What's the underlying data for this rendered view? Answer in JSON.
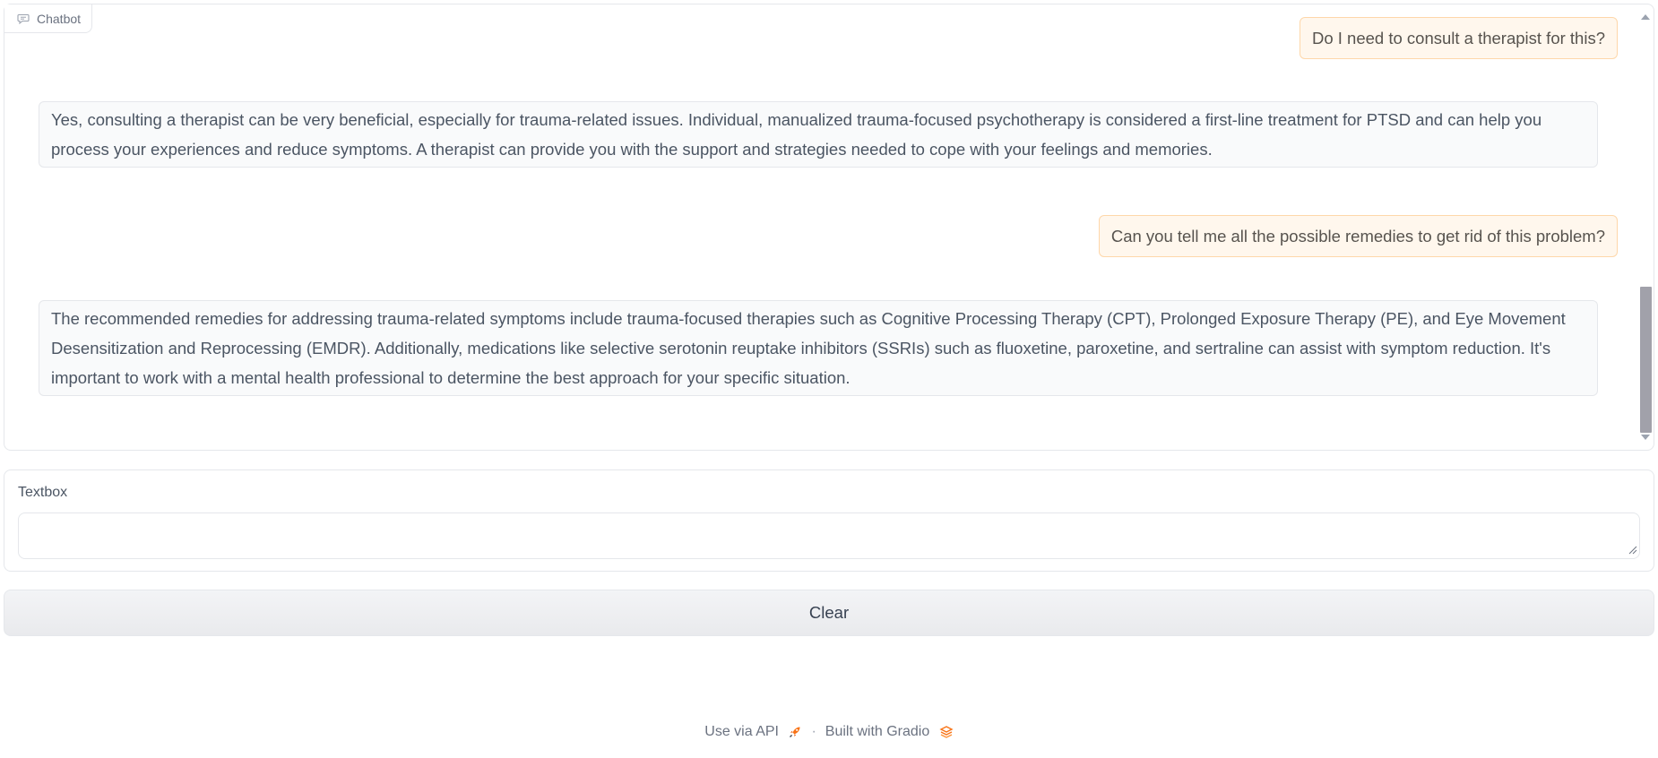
{
  "chatbot": {
    "label": "Chatbot",
    "messages": [
      {
        "role": "user",
        "text": "Do I need to consult a therapist for this?"
      },
      {
        "role": "bot",
        "text": "Yes, consulting a therapist can be very beneficial, especially for trauma-related issues. Individual, manualized trauma-focused psychotherapy is considered a first-line treatment for PTSD and can help you process your experiences and reduce symptoms. A therapist can provide you with the support and strategies needed to cope with your feelings and memories."
      },
      {
        "role": "user",
        "text": "Can you tell me all the possible remedies to get rid of this problem?"
      },
      {
        "role": "bot",
        "text": "The recommended remedies for addressing trauma-related symptoms include trauma-focused therapies such as Cognitive Processing Therapy (CPT), Prolonged Exposure Therapy (PE), and Eye Movement Desensitization and Reprocessing (EMDR). Additionally, medications like selective serotonin reuptake inhibitors (SSRIs) such as fluoxetine, paroxetine, and sertraline can assist with symptom reduction. It's important to work with a mental health professional to determine the best approach for your specific situation."
      }
    ]
  },
  "textbox": {
    "label": "Textbox",
    "value": "",
    "placeholder": ""
  },
  "clear_button": {
    "label": "Clear"
  },
  "footer": {
    "api_link": "Use via API",
    "separator": "·",
    "built_with": "Built with Gradio"
  },
  "colors": {
    "user_bubble_bg": "#fff7ed",
    "user_bubble_border": "#fed7aa",
    "bot_bubble_bg": "#f9fafb",
    "accent": "#f97316"
  },
  "icons": {
    "chatbot_label": "chat-bubble-icon",
    "api": "rocket-icon",
    "gradio": "gradio-logo-icon"
  }
}
